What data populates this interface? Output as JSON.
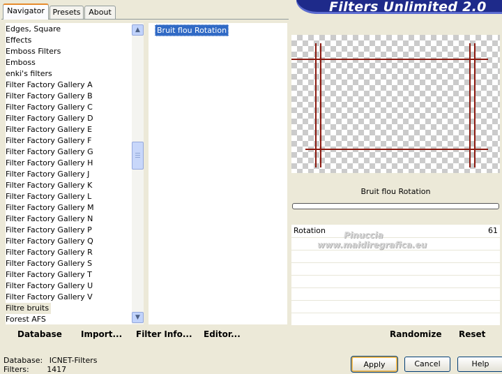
{
  "tabs": [
    "Navigator",
    "Presets",
    "About"
  ],
  "banner": "Filters Unlimited 2.0",
  "categories": [
    "Edges, Square",
    "Effects",
    "Emboss Filters",
    "Emboss",
    "enki's filters",
    "Filter Factory Gallery A",
    "Filter Factory Gallery B",
    "Filter Factory Gallery C",
    "Filter Factory Gallery D",
    "Filter Factory Gallery E",
    "Filter Factory Gallery F",
    "Filter Factory Gallery G",
    "Filter Factory Gallery H",
    "Filter Factory Gallery J",
    "Filter Factory Gallery K",
    "Filter Factory Gallery L",
    "Filter Factory Gallery M",
    "Filter Factory Gallery N",
    "Filter Factory Gallery P",
    "Filter Factory Gallery Q",
    "Filter Factory Gallery R",
    "Filter Factory Gallery S",
    "Filter Factory Gallery T",
    "Filter Factory Gallery U",
    "Filter Factory Gallery V",
    "Filtre bruits",
    "Forest AFS"
  ],
  "selected_category": "Filtre bruits",
  "filters": [
    "Bruit flou Rotation"
  ],
  "left_buttons": {
    "database": "Database",
    "import": "Import...",
    "filter_info": "Filter Info...",
    "editor": "Editor..."
  },
  "preview": {
    "filter_name": "Bruit flou Rotation",
    "line_color": "#8b1a10"
  },
  "params": [
    {
      "label": "Rotation",
      "value": "61"
    }
  ],
  "watermark": {
    "line1": "Pinuccia",
    "line2": "www.maidiregrafica.eu"
  },
  "right_buttons": {
    "randomize": "Randomize",
    "reset": "Reset"
  },
  "status": {
    "database_label": "Database:",
    "database_value": "ICNET-Filters",
    "filters_label": "Filters:",
    "filters_value": "1417"
  },
  "bottom_buttons": {
    "apply": "Apply",
    "cancel": "Cancel",
    "help": "Help"
  }
}
